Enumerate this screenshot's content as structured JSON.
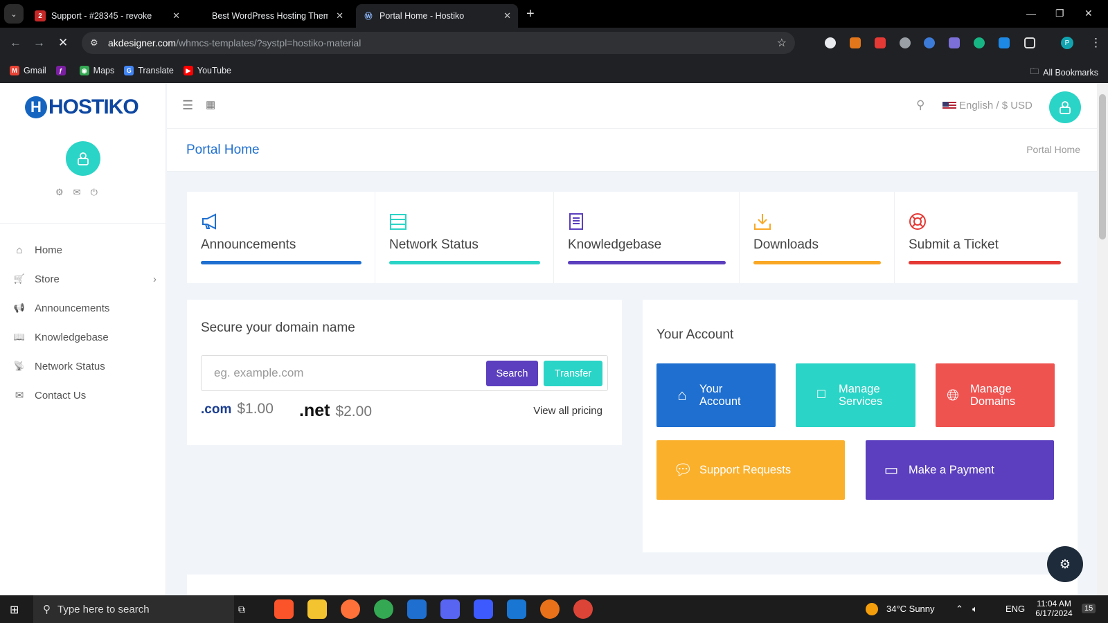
{
  "browser": {
    "tabs": [
      {
        "title": "Support - #28345 - revoke",
        "favicon": "2",
        "active": false
      },
      {
        "title": "Best WordPress Hosting Theme",
        "favicon": "",
        "active": false
      },
      {
        "title": "Portal Home - Hostiko",
        "favicon": "wp",
        "active": true
      }
    ],
    "url_domain": "akdesigner.com",
    "url_path": "/whmcs-templates/?systpl=hostiko-material",
    "bookmarks": [
      "Gmail",
      "Maps",
      "Translate",
      "YouTube"
    ],
    "all_bookmarks": "All Bookmarks",
    "profile_initial": "P"
  },
  "site": {
    "logo_letter": "H",
    "logo_text": "HOSTIKO",
    "sidebar": [
      {
        "label": "Home",
        "icon": "home-icon",
        "glyph": "⌂"
      },
      {
        "label": "Store",
        "icon": "cart-icon",
        "glyph": "🛒"
      },
      {
        "label": "Announcements",
        "icon": "megaphone-icon",
        "glyph": "📢"
      },
      {
        "label": "Knowledgebase",
        "icon": "book-icon",
        "glyph": "📖"
      },
      {
        "label": "Network Status",
        "icon": "signal-icon",
        "glyph": "📡"
      },
      {
        "label": "Contact Us",
        "icon": "envelope-icon",
        "glyph": "✉"
      }
    ],
    "topbar": {
      "language": "English / $ USD"
    },
    "page_title": "Portal Home",
    "breadcrumb": "Portal Home",
    "quick_links": [
      {
        "label": "Announcements",
        "icon": "megaphone-icon",
        "color": "#1e6fd0"
      },
      {
        "label": "Network Status",
        "icon": "server-icon",
        "color": "#2ad4c6"
      },
      {
        "label": "Knowledgebase",
        "icon": "book-icon",
        "color": "#5b3fbe"
      },
      {
        "label": "Downloads",
        "icon": "download-icon",
        "color": "#f9a825"
      },
      {
        "label": "Submit a Ticket",
        "icon": "lifebuoy-icon",
        "color": "#e53935"
      }
    ],
    "domain": {
      "heading": "Secure your domain name",
      "placeholder": "eg. example.com",
      "search_label": "Search",
      "transfer_label": "Transfer",
      "tlds": [
        {
          "name": ".com",
          "price": "$1.00"
        },
        {
          "name": ".net",
          "price": "$2.00"
        }
      ],
      "view_all": "View all pricing"
    },
    "account": {
      "heading": "Your Account",
      "buttons": [
        {
          "label": "Your Account",
          "icon": "home-icon",
          "color": "#1e6fd0"
        },
        {
          "label": "Manage Services",
          "icon": "square-icon",
          "color": "#2ad4c6"
        },
        {
          "label": "Manage Domains",
          "icon": "globe-icon",
          "color": "#ef5350"
        },
        {
          "label": "Support Requests",
          "icon": "chat-icon",
          "color": "#fbb02c"
        },
        {
          "label": "Make a Payment",
          "icon": "credit-card-icon",
          "color": "#5b3fbe"
        }
      ]
    }
  },
  "taskbar": {
    "search_placeholder": "Type here to search",
    "weather": "34°C  Sunny",
    "lang": "ENG",
    "time": "11:04 AM",
    "date": "6/17/2024",
    "notifications": "15"
  }
}
